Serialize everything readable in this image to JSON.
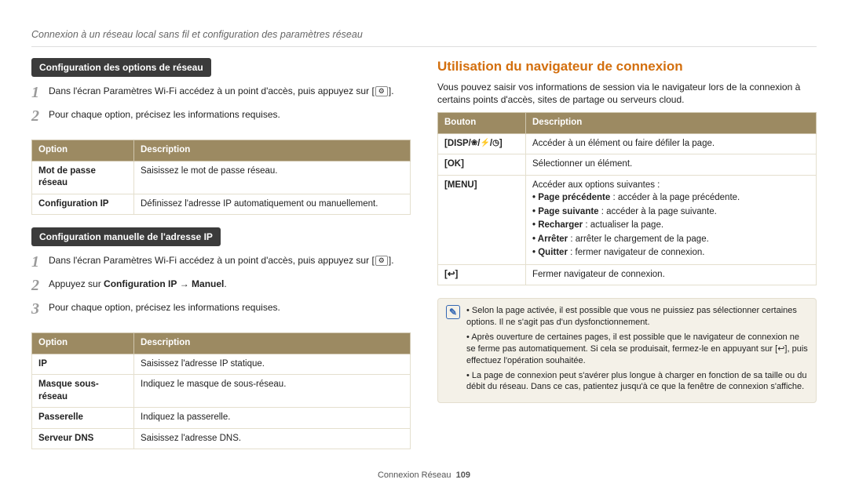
{
  "breadcrumb": "Connexion à un réseau local sans fil et configuration des paramètres réseau",
  "left": {
    "section1": {
      "title": "Configuration des options de réseau",
      "step1a": "Dans l'écran Paramètres Wi-Fi accédez à un point d'accès, puis appuyez sur",
      "step1_icon": "⚙",
      "step2": "Pour chaque option, précisez les informations requises.",
      "table": {
        "h1": "Option",
        "h2": "Description",
        "rows": [
          {
            "o": "Mot de passe réseau",
            "d": "Saisissez le mot de passe réseau."
          },
          {
            "o": "Configuration IP",
            "d": "Définissez l'adresse IP automatiquement ou manuellement."
          }
        ]
      }
    },
    "section2": {
      "title": "Configuration manuelle de l'adresse IP",
      "step1a": "Dans l'écran Paramètres Wi-Fi accédez à un point d'accès, puis appuyez sur",
      "step1_icon": "⚙",
      "step2a": "Appuyez sur ",
      "step2b": "Configuration IP",
      "step2arrow": " → ",
      "step2c": "Manuel",
      "step2d": ".",
      "step3": "Pour chaque option, précisez les informations requises.",
      "table": {
        "h1": "Option",
        "h2": "Description",
        "rows": [
          {
            "o": "IP",
            "d": "Saisissez l'adresse IP statique."
          },
          {
            "o": "Masque sous-réseau",
            "d": "Indiquez le masque de sous-réseau."
          },
          {
            "o": "Passerelle",
            "d": "Indiquez la passerelle."
          },
          {
            "o": "Serveur DNS",
            "d": "Saisissez l'adresse DNS."
          }
        ]
      }
    }
  },
  "right": {
    "heading": "Utilisation du navigateur de connexion",
    "intro": "Vous pouvez saisir vos informations de session via le navigateur lors de la connexion à certains points d'accès, sites de partage ou serveurs cloud.",
    "table": {
      "h1": "Bouton",
      "h2": "Description",
      "row1_btn": "[DISP/",
      "row1_btn_tail": "]",
      "row1_desc": "Accéder à un élément ou faire défiler la page.",
      "row2_btn": "[OK]",
      "row2_desc": "Sélectionner un élément.",
      "row3_btn": "[MENU]",
      "row3_desc_intro": "Accéder aux options suivantes :",
      "row3_items": [
        {
          "b": "Page précédente",
          "t": " : accéder à la page précédente."
        },
        {
          "b": "Page suivante",
          "t": " : accéder à la page suivante."
        },
        {
          "b": "Recharger",
          "t": " : actualiser la page."
        },
        {
          "b": "Arrêter",
          "t": " : arrêter le chargement de la page."
        },
        {
          "b": "Quitter",
          "t": " : fermer navigateur de connexion."
        }
      ],
      "row4_btn": "[↩]",
      "row4_desc": "Fermer navigateur de connexion."
    },
    "info": {
      "items": [
        "Selon la page activée, il est possible que vous ne puissiez pas sélectionner certaines options. Il ne s'agit pas d'un dysfonctionnement.",
        "Après ouverture de certaines pages, il est possible que le navigateur de connexion ne se ferme pas automatiquement. Si cela se produisait, fermez-le en appuyant sur [↩], puis effectuez l'opération souhaitée.",
        "La page de connexion peut s'avérer plus longue à charger en fonction de sa taille ou du débit du réseau. Dans ce cas, patientez jusqu'à ce que la fenêtre de connexion s'affiche."
      ]
    }
  },
  "footer_section": "Connexion Réseau",
  "footer_page": "109"
}
